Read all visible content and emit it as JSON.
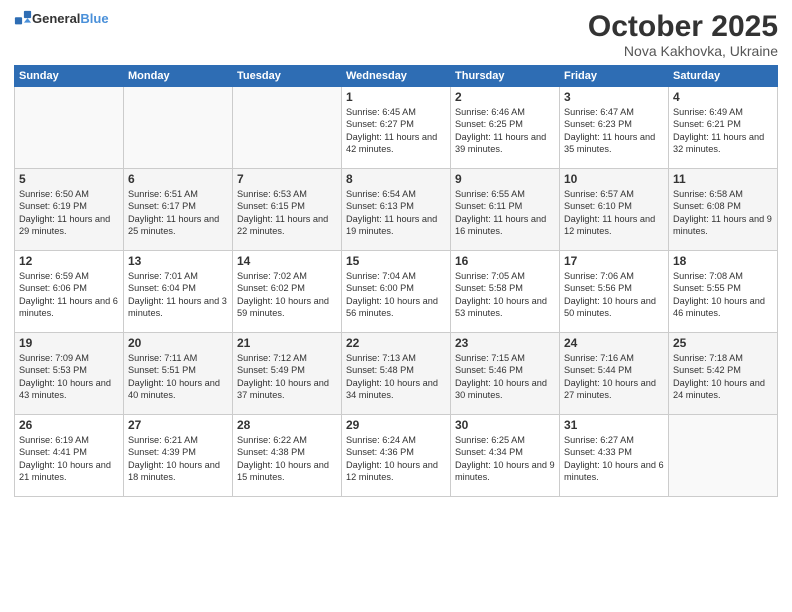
{
  "header": {
    "logo_general": "General",
    "logo_blue": "Blue",
    "month": "October 2025",
    "location": "Nova Kakhovka, Ukraine"
  },
  "weekdays": [
    "Sunday",
    "Monday",
    "Tuesday",
    "Wednesday",
    "Thursday",
    "Friday",
    "Saturday"
  ],
  "weeks": [
    [
      {
        "day": "",
        "info": ""
      },
      {
        "day": "",
        "info": ""
      },
      {
        "day": "",
        "info": ""
      },
      {
        "day": "1",
        "info": "Sunrise: 6:45 AM\nSunset: 6:27 PM\nDaylight: 11 hours\nand 42 minutes."
      },
      {
        "day": "2",
        "info": "Sunrise: 6:46 AM\nSunset: 6:25 PM\nDaylight: 11 hours\nand 39 minutes."
      },
      {
        "day": "3",
        "info": "Sunrise: 6:47 AM\nSunset: 6:23 PM\nDaylight: 11 hours\nand 35 minutes."
      },
      {
        "day": "4",
        "info": "Sunrise: 6:49 AM\nSunset: 6:21 PM\nDaylight: 11 hours\nand 32 minutes."
      }
    ],
    [
      {
        "day": "5",
        "info": "Sunrise: 6:50 AM\nSunset: 6:19 PM\nDaylight: 11 hours\nand 29 minutes."
      },
      {
        "day": "6",
        "info": "Sunrise: 6:51 AM\nSunset: 6:17 PM\nDaylight: 11 hours\nand 25 minutes."
      },
      {
        "day": "7",
        "info": "Sunrise: 6:53 AM\nSunset: 6:15 PM\nDaylight: 11 hours\nand 22 minutes."
      },
      {
        "day": "8",
        "info": "Sunrise: 6:54 AM\nSunset: 6:13 PM\nDaylight: 11 hours\nand 19 minutes."
      },
      {
        "day": "9",
        "info": "Sunrise: 6:55 AM\nSunset: 6:11 PM\nDaylight: 11 hours\nand 16 minutes."
      },
      {
        "day": "10",
        "info": "Sunrise: 6:57 AM\nSunset: 6:10 PM\nDaylight: 11 hours\nand 12 minutes."
      },
      {
        "day": "11",
        "info": "Sunrise: 6:58 AM\nSunset: 6:08 PM\nDaylight: 11 hours\nand 9 minutes."
      }
    ],
    [
      {
        "day": "12",
        "info": "Sunrise: 6:59 AM\nSunset: 6:06 PM\nDaylight: 11 hours\nand 6 minutes."
      },
      {
        "day": "13",
        "info": "Sunrise: 7:01 AM\nSunset: 6:04 PM\nDaylight: 11 hours\nand 3 minutes."
      },
      {
        "day": "14",
        "info": "Sunrise: 7:02 AM\nSunset: 6:02 PM\nDaylight: 10 hours\nand 59 minutes."
      },
      {
        "day": "15",
        "info": "Sunrise: 7:04 AM\nSunset: 6:00 PM\nDaylight: 10 hours\nand 56 minutes."
      },
      {
        "day": "16",
        "info": "Sunrise: 7:05 AM\nSunset: 5:58 PM\nDaylight: 10 hours\nand 53 minutes."
      },
      {
        "day": "17",
        "info": "Sunrise: 7:06 AM\nSunset: 5:56 PM\nDaylight: 10 hours\nand 50 minutes."
      },
      {
        "day": "18",
        "info": "Sunrise: 7:08 AM\nSunset: 5:55 PM\nDaylight: 10 hours\nand 46 minutes."
      }
    ],
    [
      {
        "day": "19",
        "info": "Sunrise: 7:09 AM\nSunset: 5:53 PM\nDaylight: 10 hours\nand 43 minutes."
      },
      {
        "day": "20",
        "info": "Sunrise: 7:11 AM\nSunset: 5:51 PM\nDaylight: 10 hours\nand 40 minutes."
      },
      {
        "day": "21",
        "info": "Sunrise: 7:12 AM\nSunset: 5:49 PM\nDaylight: 10 hours\nand 37 minutes."
      },
      {
        "day": "22",
        "info": "Sunrise: 7:13 AM\nSunset: 5:48 PM\nDaylight: 10 hours\nand 34 minutes."
      },
      {
        "day": "23",
        "info": "Sunrise: 7:15 AM\nSunset: 5:46 PM\nDaylight: 10 hours\nand 30 minutes."
      },
      {
        "day": "24",
        "info": "Sunrise: 7:16 AM\nSunset: 5:44 PM\nDaylight: 10 hours\nand 27 minutes."
      },
      {
        "day": "25",
        "info": "Sunrise: 7:18 AM\nSunset: 5:42 PM\nDaylight: 10 hours\nand 24 minutes."
      }
    ],
    [
      {
        "day": "26",
        "info": "Sunrise: 6:19 AM\nSunset: 4:41 PM\nDaylight: 10 hours\nand 21 minutes."
      },
      {
        "day": "27",
        "info": "Sunrise: 6:21 AM\nSunset: 4:39 PM\nDaylight: 10 hours\nand 18 minutes."
      },
      {
        "day": "28",
        "info": "Sunrise: 6:22 AM\nSunset: 4:38 PM\nDaylight: 10 hours\nand 15 minutes."
      },
      {
        "day": "29",
        "info": "Sunrise: 6:24 AM\nSunset: 4:36 PM\nDaylight: 10 hours\nand 12 minutes."
      },
      {
        "day": "30",
        "info": "Sunrise: 6:25 AM\nSunset: 4:34 PM\nDaylight: 10 hours\nand 9 minutes."
      },
      {
        "day": "31",
        "info": "Sunrise: 6:27 AM\nSunset: 4:33 PM\nDaylight: 10 hours\nand 6 minutes."
      },
      {
        "day": "",
        "info": ""
      }
    ]
  ]
}
